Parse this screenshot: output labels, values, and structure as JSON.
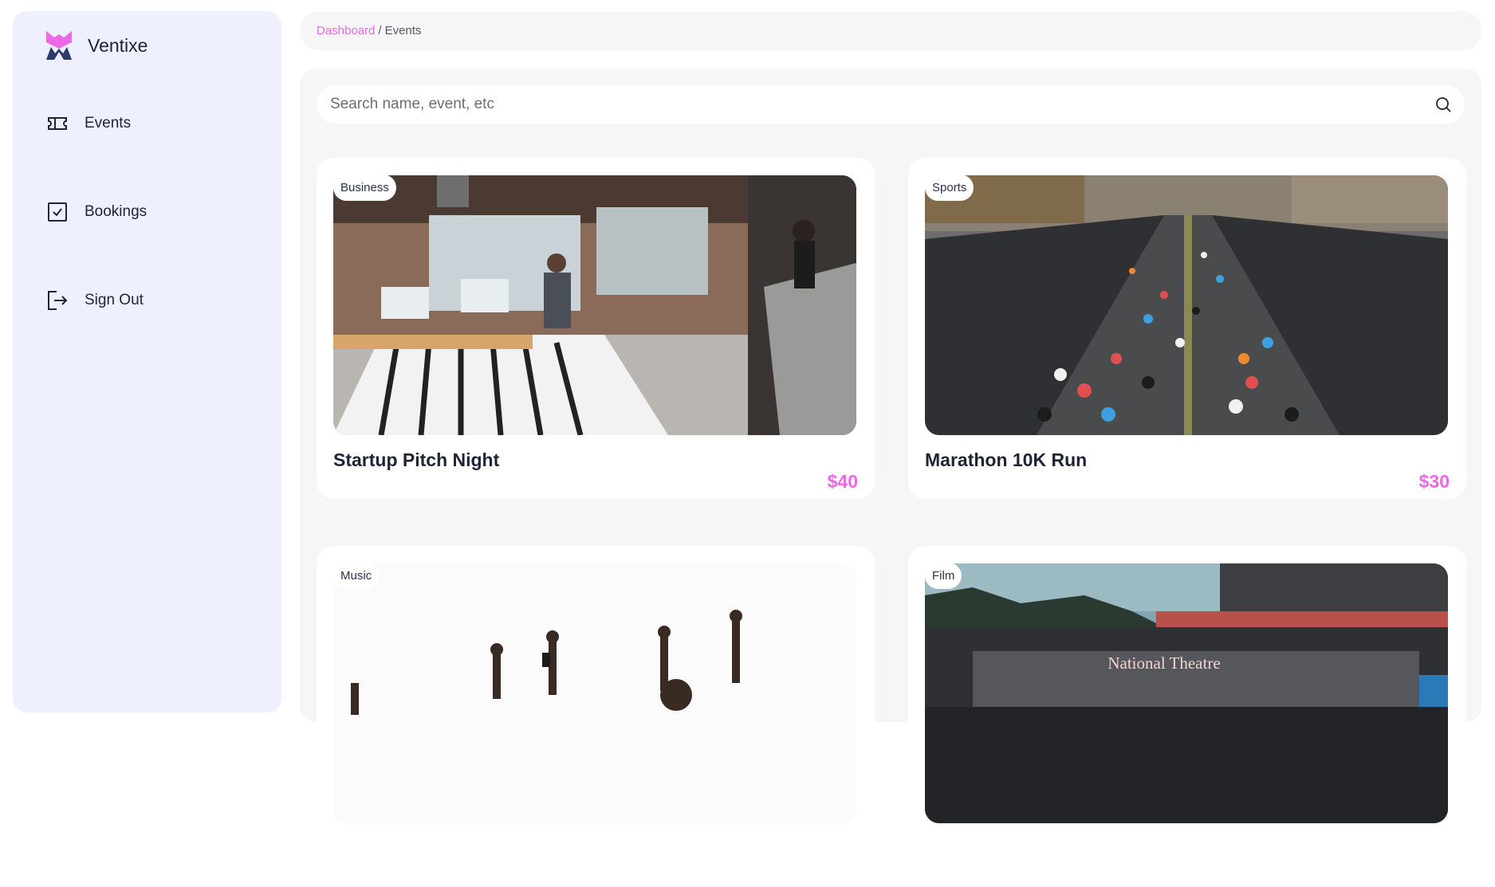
{
  "brand": {
    "name": "Ventixe"
  },
  "sidebar": {
    "items": [
      {
        "label": "Events",
        "icon": "ticket-icon"
      },
      {
        "label": "Bookings",
        "icon": "check-square-icon"
      },
      {
        "label": "Sign Out",
        "icon": "sign-out-icon"
      }
    ]
  },
  "breadcrumb": {
    "root": "Dashboard",
    "separator": "/",
    "current": "Events"
  },
  "search": {
    "placeholder": "Search name, event, etc",
    "value": ""
  },
  "events": [
    {
      "category": "Business",
      "title": "Startup Pitch Night",
      "price": "$40",
      "image": "office-scene"
    },
    {
      "category": "Sports",
      "title": "Marathon 10K Run",
      "price": "$30",
      "image": "marathon-scene"
    },
    {
      "category": "Music",
      "title": "",
      "price": "",
      "image": "crowd-scene"
    },
    {
      "category": "Film",
      "title": "",
      "price": "",
      "image": "theatre-scene",
      "image_text": "National Theatre"
    }
  ],
  "colors": {
    "accent": "#EC68E6",
    "sidebar_bg": "#EEEFFF",
    "panel_bg": "#F6F6F7",
    "text": "#1E2436"
  }
}
